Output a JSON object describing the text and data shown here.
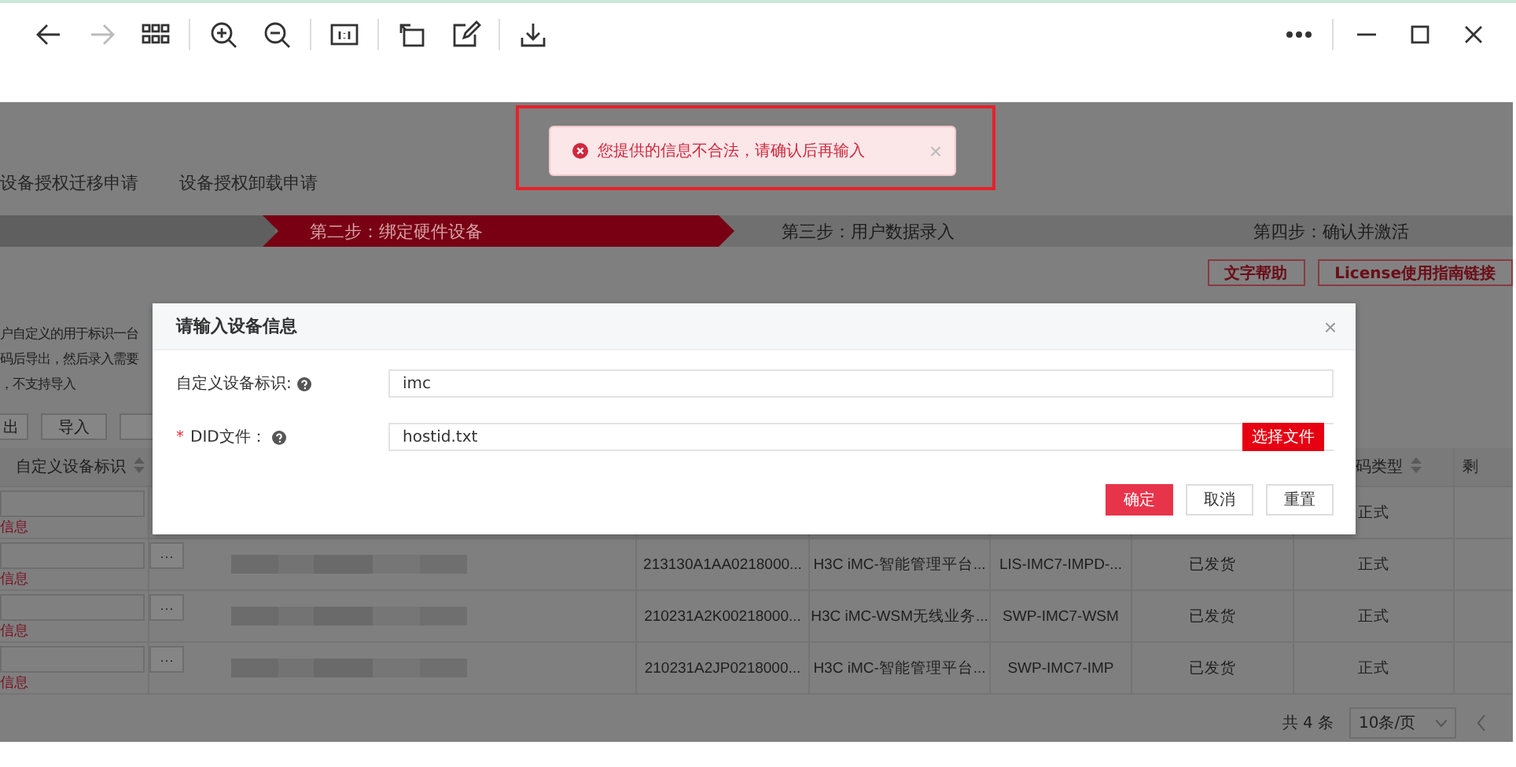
{
  "browser_toolbar": {
    "buttons": [
      {
        "kind": "back",
        "disabled": false
      },
      {
        "kind": "forward",
        "disabled": true
      },
      {
        "kind": "grid",
        "disabled": false
      },
      {
        "kind": "zoom-in",
        "disabled": false
      },
      {
        "kind": "zoom-out",
        "disabled": false
      },
      {
        "kind": "actual-size",
        "disabled": false
      },
      {
        "kind": "rotate",
        "disabled": false
      },
      {
        "kind": "edit",
        "disabled": false
      },
      {
        "kind": "download",
        "disabled": false
      }
    ],
    "window_buttons": [
      {
        "kind": "more"
      },
      {
        "kind": "minimize"
      },
      {
        "kind": "maximize"
      },
      {
        "kind": "close"
      }
    ]
  },
  "toast": {
    "message": "您提供的信息不合法，请确认后再输入",
    "close": "×"
  },
  "tabs": [
    {
      "label": "设备授权迁移申请"
    },
    {
      "label": "设备授权卸载申请"
    }
  ],
  "steps": [
    {
      "completed": true,
      "selected": false
    },
    {
      "label": "第二步：绑定硬件设备",
      "completed": false,
      "selected": true
    },
    {
      "label": "第三步：用户数据录入",
      "completed": false,
      "selected": false
    },
    {
      "label": "第四步：确认并激活",
      "completed": false,
      "selected": false
    }
  ],
  "help_buttons": [
    "文字帮助",
    "License使用指南链接"
  ],
  "intro_lines": [
    "户自定义的用于标识一台",
    "码后导出，然后录入需要",
    "，不支持导入"
  ],
  "action_buttons": [
    "出",
    "导入"
  ],
  "table": {
    "columns": [
      {
        "label": "自定义设备标识",
        "sortable": true
      },
      {
        "label": "码类型",
        "sortable": true
      },
      {
        "label": "剩",
        "sortable": false
      }
    ],
    "rows": [
      {
        "error": "信息",
        "type": "正式"
      },
      {
        "picker": "···",
        "error": "信息",
        "serial": "213130A1AA0218000...",
        "product": "H3C iMC-智能管理平台...",
        "code": "LIS-IMC7-IMPD-...",
        "status": "已发货",
        "type": "正式"
      },
      {
        "picker": "···",
        "error": "信息",
        "serial": "210231A2K00218000...",
        "product": "H3C iMC-WSM无线业务...",
        "code": "SWP-IMC7-WSM",
        "status": "已发货",
        "type": "正式"
      },
      {
        "picker": "···",
        "error": "信息",
        "serial": "210231A2JP0218000...",
        "product": "H3C iMC-智能管理平台...",
        "code": "SWP-IMC7-IMP",
        "status": "已发货",
        "type": "正式"
      }
    ]
  },
  "pagination": {
    "total": "共 4 条",
    "page_size": "10条/页"
  },
  "dialog": {
    "title": "请输入设备信息",
    "close": "×",
    "fields": [
      {
        "label": "自定义设备标识:",
        "value": "imc"
      },
      {
        "marker": "*",
        "label": "DID文件：",
        "value": "hostid.txt",
        "button": "选择文件"
      }
    ],
    "buttons": [
      {
        "label": "确定",
        "primary": true
      },
      {
        "label": "取消",
        "primary": false
      },
      {
        "label": "重置",
        "primary": false
      }
    ]
  }
}
